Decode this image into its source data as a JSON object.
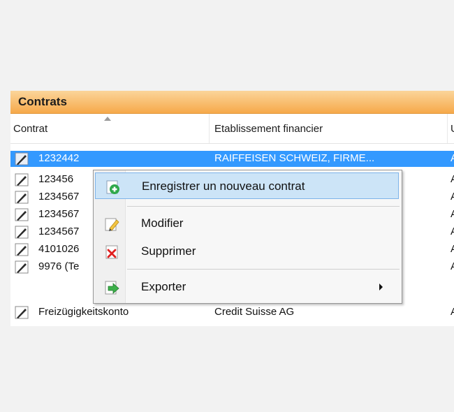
{
  "panel": {
    "title": "Contrats",
    "columns": [
      "Contrat",
      "Etablissement financier",
      "U"
    ]
  },
  "rows": [
    {
      "contract": "1232442",
      "institution": "RAIFFEISEN SCHWEIZ, FIRME...",
      "col3": "A",
      "selected": true
    },
    {
      "contract": "123456",
      "institution": "",
      "col3": "A",
      "selected": false
    },
    {
      "contract": "1234567",
      "institution": "",
      "col3": "A",
      "selected": false
    },
    {
      "contract": "1234567",
      "institution": "",
      "col3": "A",
      "selected": false
    },
    {
      "contract": "1234567",
      "institution": "",
      "col3": "A",
      "selected": false
    },
    {
      "contract": "4101026",
      "institution": "",
      "col3": "A",
      "selected": false
    },
    {
      "contract": "9976 (Te",
      "institution": "",
      "col3": "A",
      "selected": false
    },
    {
      "contract": "Freizügigkeitskonto",
      "institution": "Credit Suisse AG",
      "col3": "A",
      "selected": false
    }
  ],
  "context_menu": {
    "items": [
      {
        "label": "Enregistrer un nouveau contrat",
        "icon": "add-contract-icon",
        "highlighted": true
      },
      {
        "label": "Modifier",
        "icon": "edit-pencil-icon",
        "highlighted": false
      },
      {
        "label": "Supprimer",
        "icon": "delete-x-icon",
        "highlighted": false
      },
      {
        "label": "Exporter",
        "icon": "export-arrow-icon",
        "highlighted": false,
        "has_submenu": true
      }
    ]
  },
  "colors": {
    "header_orange": "#f6a94a",
    "selection_blue": "#3399ff",
    "menu_highlight": "#cce4f7"
  }
}
